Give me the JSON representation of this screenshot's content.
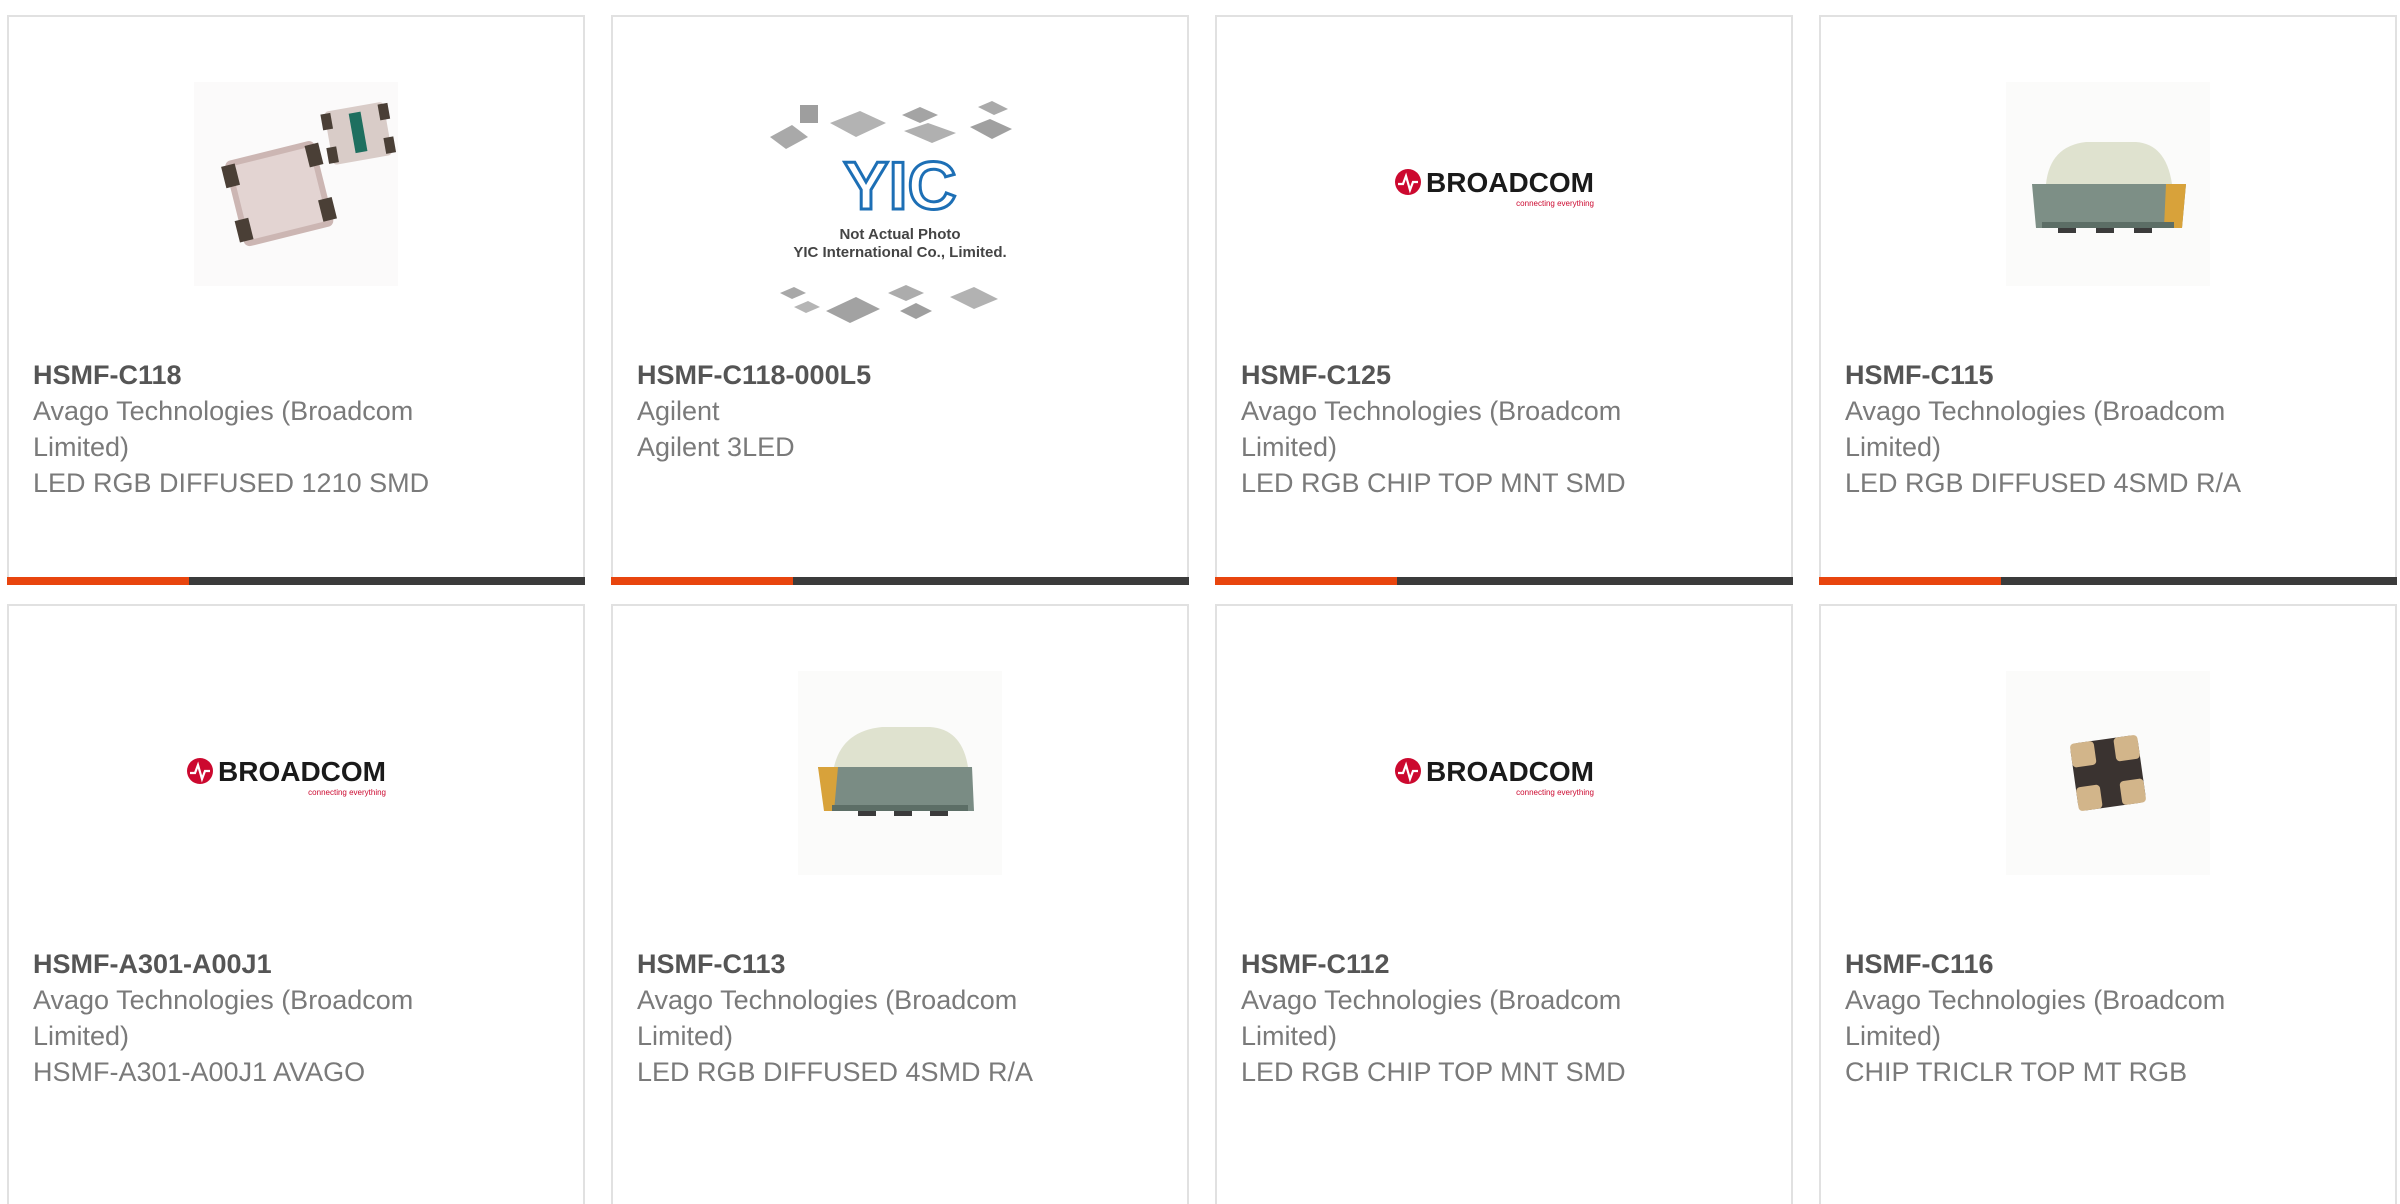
{
  "accent_color": "#e8450e",
  "track_color": "#3b3b3b",
  "products": [
    {
      "part_number": "HSMF-C118",
      "manufacturer": "Avago Technologies (Broadcom Limited)",
      "description": "LED RGB DIFFUSED 1210 SMD",
      "image": "led-chip-pair-photo"
    },
    {
      "part_number": "HSMF-C118-000L5",
      "manufacturer": "Agilent",
      "description": "Agilent 3LED",
      "image": "placeholder-not-actual-photo",
      "placeholder_line1": "Not Actual Photo",
      "placeholder_line2": "YIC International Co., Limited.",
      "placeholder_logo": "YIC"
    },
    {
      "part_number": "HSMF-C125",
      "manufacturer": "Avago Technologies (Broadcom Limited)",
      "description": "LED RGB CHIP TOP MNT SMD",
      "image": "broadcom-logo",
      "logo_text": "BROADCOM",
      "logo_tagline": "connecting everything"
    },
    {
      "part_number": "HSMF-C115",
      "manufacturer": "Avago Technologies (Broadcom Limited)",
      "description": "LED RGB DIFFUSED 4SMD R/A",
      "image": "led-right-angle-photo"
    },
    {
      "part_number": "HSMF-A301-A00J1",
      "manufacturer": "Avago Technologies (Broadcom Limited)",
      "description": "HSMF-A301-A00J1 AVAGO",
      "image": "broadcom-logo",
      "logo_text": "BROADCOM",
      "logo_tagline": "connecting everything"
    },
    {
      "part_number": "HSMF-C113",
      "manufacturer": "Avago Technologies (Broadcom Limited)",
      "description": "LED RGB DIFFUSED 4SMD R/A",
      "image": "led-right-angle-photo"
    },
    {
      "part_number": "HSMF-C112",
      "manufacturer": "Avago Technologies (Broadcom Limited)",
      "description": "LED RGB CHIP TOP MNT SMD",
      "image": "broadcom-logo",
      "logo_text": "BROADCOM",
      "logo_tagline": "connecting everything"
    },
    {
      "part_number": "HSMF-C116",
      "manufacturer": "Avago Technologies (Broadcom Limited)",
      "description": "CHIP TRICLR TOP MT RGB",
      "image": "led-tiny-chip-photo"
    }
  ]
}
